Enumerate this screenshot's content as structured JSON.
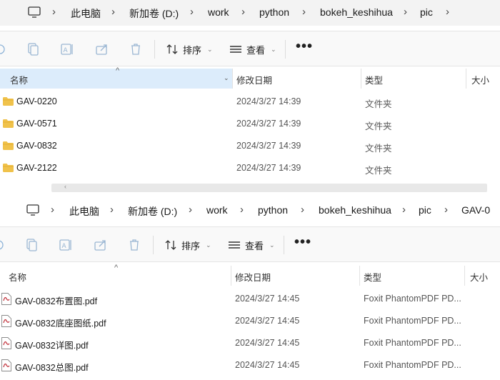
{
  "window1": {
    "breadcrumb": [
      "此电脑",
      "新加卷 (D:)",
      "work",
      "python",
      "bokeh_keshihua",
      "pic"
    ],
    "toolbar": {
      "sort_label": "排序",
      "view_label": "查看",
      "more_label": "•••"
    },
    "columns": {
      "name": "名称",
      "date": "修改日期",
      "type": "类型",
      "size": "大小"
    },
    "rows": [
      {
        "name": "GAV-0220",
        "date": "2024/3/27 14:39",
        "type": "文件夹"
      },
      {
        "name": "GAV-0571",
        "date": "2024/3/27 14:39",
        "type": "文件夹"
      },
      {
        "name": "GAV-0832",
        "date": "2024/3/27 14:39",
        "type": "文件夹"
      },
      {
        "name": "GAV-2122",
        "date": "2024/3/27 14:39",
        "type": "文件夹"
      }
    ]
  },
  "window2": {
    "breadcrumb": [
      "此电脑",
      "新加卷 (D:)",
      "work",
      "python",
      "bokeh_keshihua",
      "pic",
      "GAV-0"
    ],
    "toolbar": {
      "sort_label": "排序",
      "view_label": "查看",
      "more_label": "•••"
    },
    "columns": {
      "name": "名称",
      "date": "修改日期",
      "type": "类型",
      "size": "大小"
    },
    "rows": [
      {
        "name": "GAV-0832布置图.pdf",
        "date": "2024/3/27 14:45",
        "type": "Foxit PhantomPDF PD..."
      },
      {
        "name": "GAV-0832底座图纸.pdf",
        "date": "2024/3/27 14:45",
        "type": "Foxit PhantomPDF PD..."
      },
      {
        "name": "GAV-0832详图.pdf",
        "date": "2024/3/27 14:45",
        "type": "Foxit PhantomPDF PD..."
      },
      {
        "name": "GAV-0832总图.pdf",
        "date": "2024/3/27 14:45",
        "type": "Foxit PhantomPDF PD..."
      }
    ]
  },
  "colors": {
    "selected_column": "#dcecfb",
    "folder": "#f0c24b",
    "pdf_red": "#c0303a"
  }
}
